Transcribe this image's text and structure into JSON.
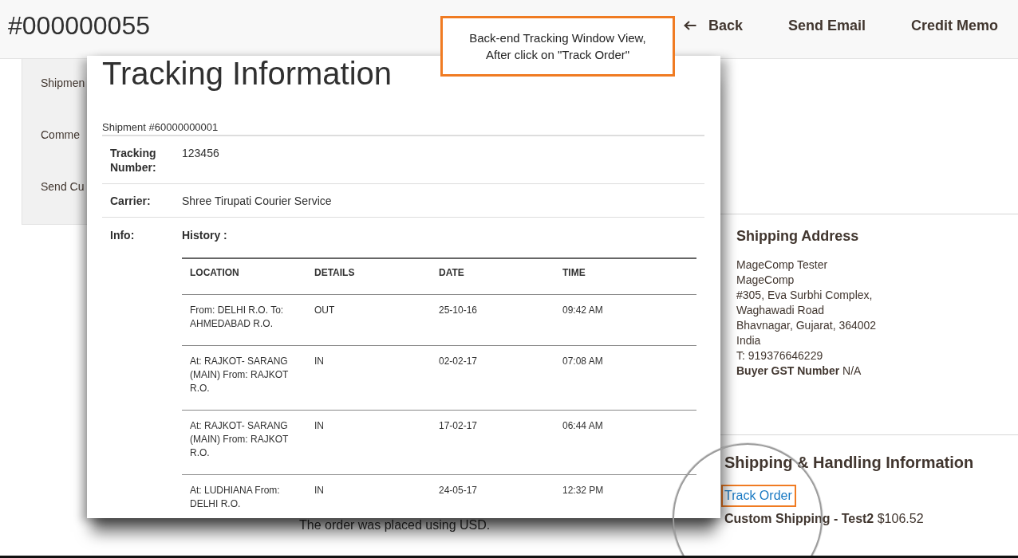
{
  "header": {
    "title": "#000000055",
    "actions": [
      {
        "label": "Back",
        "kind": "back"
      },
      {
        "label": "Send Email",
        "kind": "text"
      },
      {
        "label": "Credit Memo",
        "kind": "text"
      }
    ]
  },
  "annotation": {
    "text": "Back-end Tracking Window View,\nAfter click on \"Track Order\""
  },
  "sidebar": {
    "items": [
      "Shipmen",
      "Comme",
      "Send Cu"
    ]
  },
  "tracking_popup": {
    "title": "Tracking Information",
    "shipment": "Shipment #60000000001",
    "fields": [
      {
        "label": "Tracking Number:",
        "value": "123456"
      },
      {
        "label": "Carrier:",
        "value": "Shree Tirupati Courier Service"
      }
    ],
    "info_label": "Info:",
    "history_label": "History :",
    "history": {
      "columns": [
        "LOCATION",
        "DETAILS",
        "DATE",
        "TIME"
      ],
      "rows": [
        [
          "From: DELHI R.O. To: AHMEDABAD R.O.",
          "OUT",
          "25-10-16",
          "09:42 AM"
        ],
        [
          "At: RAJKOT- SARANG (MAIN) From: RAJKOT R.O.",
          "IN",
          "02-02-17",
          "07:08 AM"
        ],
        [
          "At: RAJKOT- SARANG (MAIN) From: RAJKOT R.O.",
          "IN",
          "17-02-17",
          "06:44 AM"
        ],
        [
          "At: LUDHIANA From: DELHI R.O.",
          "IN",
          "24-05-17",
          "12:32 PM"
        ]
      ]
    }
  },
  "order_note": "The order was placed using USD.",
  "shipping_address": {
    "title": "Shipping Address",
    "lines": [
      "MageComp Tester",
      "MageComp",
      "#305, Eva Surbhi Complex,",
      "Waghawadi Road",
      "Bhavnagar, Gujarat, 364002",
      "India",
      "T: 919376646229"
    ],
    "gst": "**Buyer GST Number** N/A"
  },
  "shipping_handling": {
    "title": "Shipping & Handling Information",
    "track_link": {
      "label": "Track Order",
      "highlighted": true
    },
    "method": "**Custom Shipping - Test2** $106.52"
  }
}
